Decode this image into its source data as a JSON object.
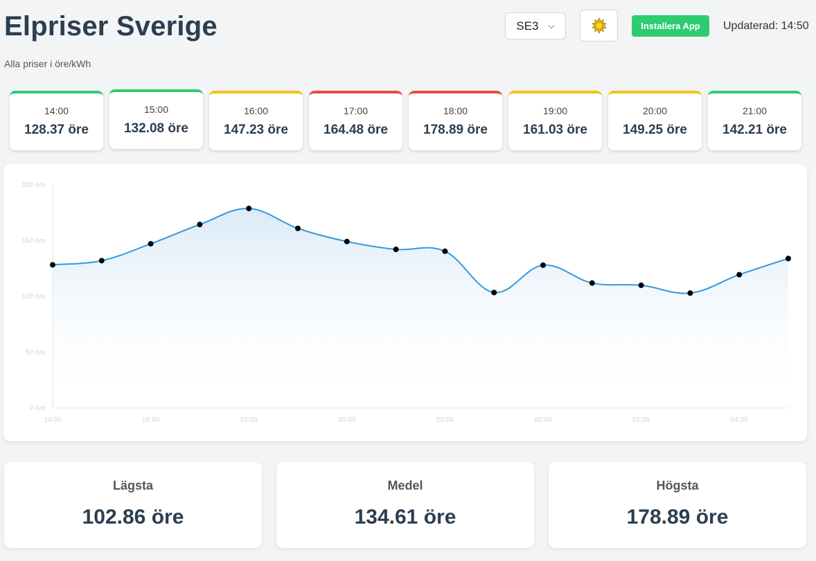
{
  "header": {
    "title": "Elpriser Sverige",
    "subtitle": "Alla priser i öre/kWh",
    "region": "SE3",
    "install_label": "Installera App",
    "updated": "Updaterad: 14:50",
    "theme_icon": "sun-icon"
  },
  "hours": [
    {
      "time": "14:00",
      "price": "128.37 öre",
      "color": "#2ecc71"
    },
    {
      "time": "15:00",
      "price": "132.08 öre",
      "color": "#2ecc71"
    },
    {
      "time": "16:00",
      "price": "147.23 öre",
      "color": "#f1c40f"
    },
    {
      "time": "17:00",
      "price": "164.48 öre",
      "color": "#e74c3c"
    },
    {
      "time": "18:00",
      "price": "178.89 öre",
      "color": "#e74c3c"
    },
    {
      "time": "19:00",
      "price": "161.03 öre",
      "color": "#f1c40f"
    },
    {
      "time": "20:00",
      "price": "149.25 öre",
      "color": "#f1c40f"
    },
    {
      "time": "21:00",
      "price": "142.21 öre",
      "color": "#2ecc71"
    }
  ],
  "stats": [
    {
      "label": "Lägsta",
      "value": "102.86 öre"
    },
    {
      "label": "Medel",
      "value": "134.61 öre"
    },
    {
      "label": "Högsta",
      "value": "178.89 öre"
    }
  ],
  "chart_data": {
    "type": "line",
    "x": [
      "14:00",
      "15:00",
      "16:00",
      "17:00",
      "18:00",
      "19:00",
      "20:00",
      "21:00",
      "22:00",
      "23:00",
      "00:00",
      "01:00",
      "02:00",
      "03:00",
      "04:00",
      "05:00"
    ],
    "x_tick_labels": [
      "14:00",
      "16:00",
      "18:00",
      "20:00",
      "22:00",
      "00:00",
      "02:00",
      "04:00"
    ],
    "y_tick_labels": [
      "0 öre",
      "50 öre",
      "100 öre",
      "150 öre",
      "200 öre"
    ],
    "ylim": [
      0,
      200
    ],
    "series": [
      {
        "values": [
          128.37,
          132.08,
          147.23,
          164.48,
          178.89,
          161.03,
          149.25,
          142.21,
          140.5,
          103.5,
          128.0,
          112.0,
          110.0,
          103.0,
          119.5,
          134.0
        ]
      }
    ],
    "line_color": "#3498db",
    "point_color": "#000000",
    "grid": false,
    "legend": "none"
  }
}
